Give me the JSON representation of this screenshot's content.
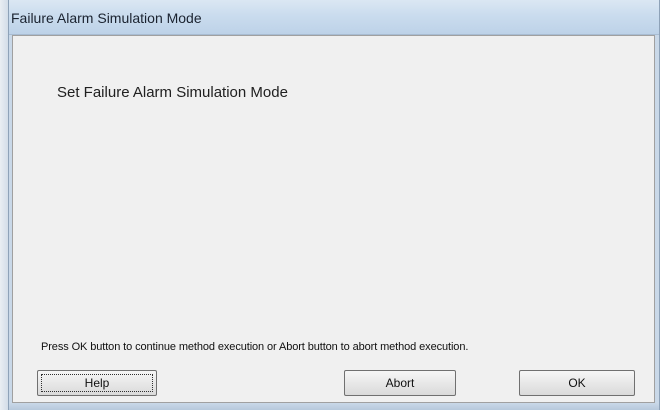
{
  "window": {
    "title": "Failure Alarm Simulation Mode"
  },
  "dialog": {
    "heading": "Set Failure Alarm Simulation Mode",
    "message": "Press OK button to continue method execution or Abort button to abort method execution."
  },
  "buttons": {
    "help": "Help",
    "abort": "Abort",
    "ok": "OK"
  },
  "colors": {
    "titlebar": "#cadcee",
    "client_background": "#f0f0f0"
  }
}
